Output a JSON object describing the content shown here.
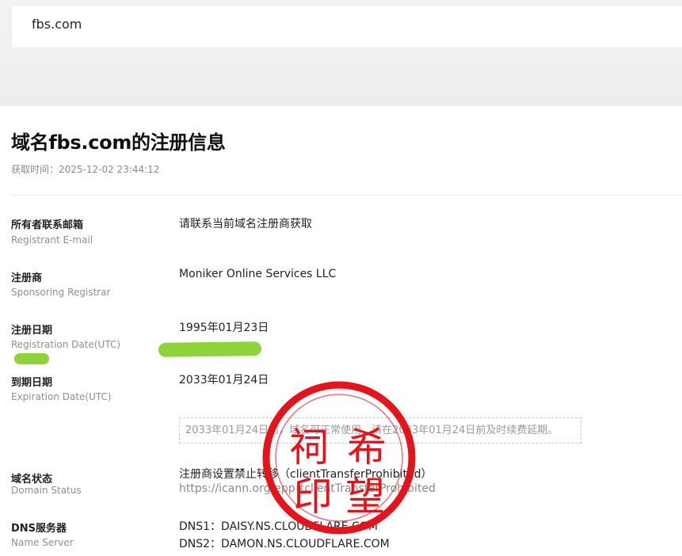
{
  "search": {
    "value": "fbs.com"
  },
  "page": {
    "title": "域名fbs.com的注册信息",
    "fetch_time": "获取时间：2025-12-02 23:44:12"
  },
  "fields": {
    "email": {
      "label_zh": "所有者联系邮箱",
      "label_en": "Registrant E-mail",
      "value": "请联系当前域名注册商获取"
    },
    "registrar": {
      "label_zh": "注册商",
      "label_en": "Sponsoring Registrar",
      "value": "Moniker Online Services LLC"
    },
    "reg_date": {
      "label_zh": "注册日期",
      "label_en": "Registration Date(UTC)",
      "value": "1995年01月23日"
    },
    "exp_date": {
      "label_zh": "到期日期",
      "label_en": "Expiration Date(UTC)",
      "value": "2033年01月24日",
      "note": "2033年01月24日前，域名可正常使用，请在2033年01月24日前及时续费延期。"
    },
    "status": {
      "label_zh": "域名状态",
      "label_en": "Domain Status",
      "value": "注册商设置禁止转移（clientTransferProhibited）",
      "link": "https://icann.org/epp#clientTransferProhibited"
    },
    "dns": {
      "label_zh": "DNS服务器",
      "label_en": "Name Server",
      "ns1": "DNS1：DAISY.NS.CLOUDFLARE.COM",
      "ns2": "DNS2：DAMON.NS.CLOUDFLARE.COM"
    }
  },
  "stamp": {
    "text": "祠希印望",
    "color": "#e4141c"
  },
  "colors": {
    "highlight": "#8ed33a"
  }
}
